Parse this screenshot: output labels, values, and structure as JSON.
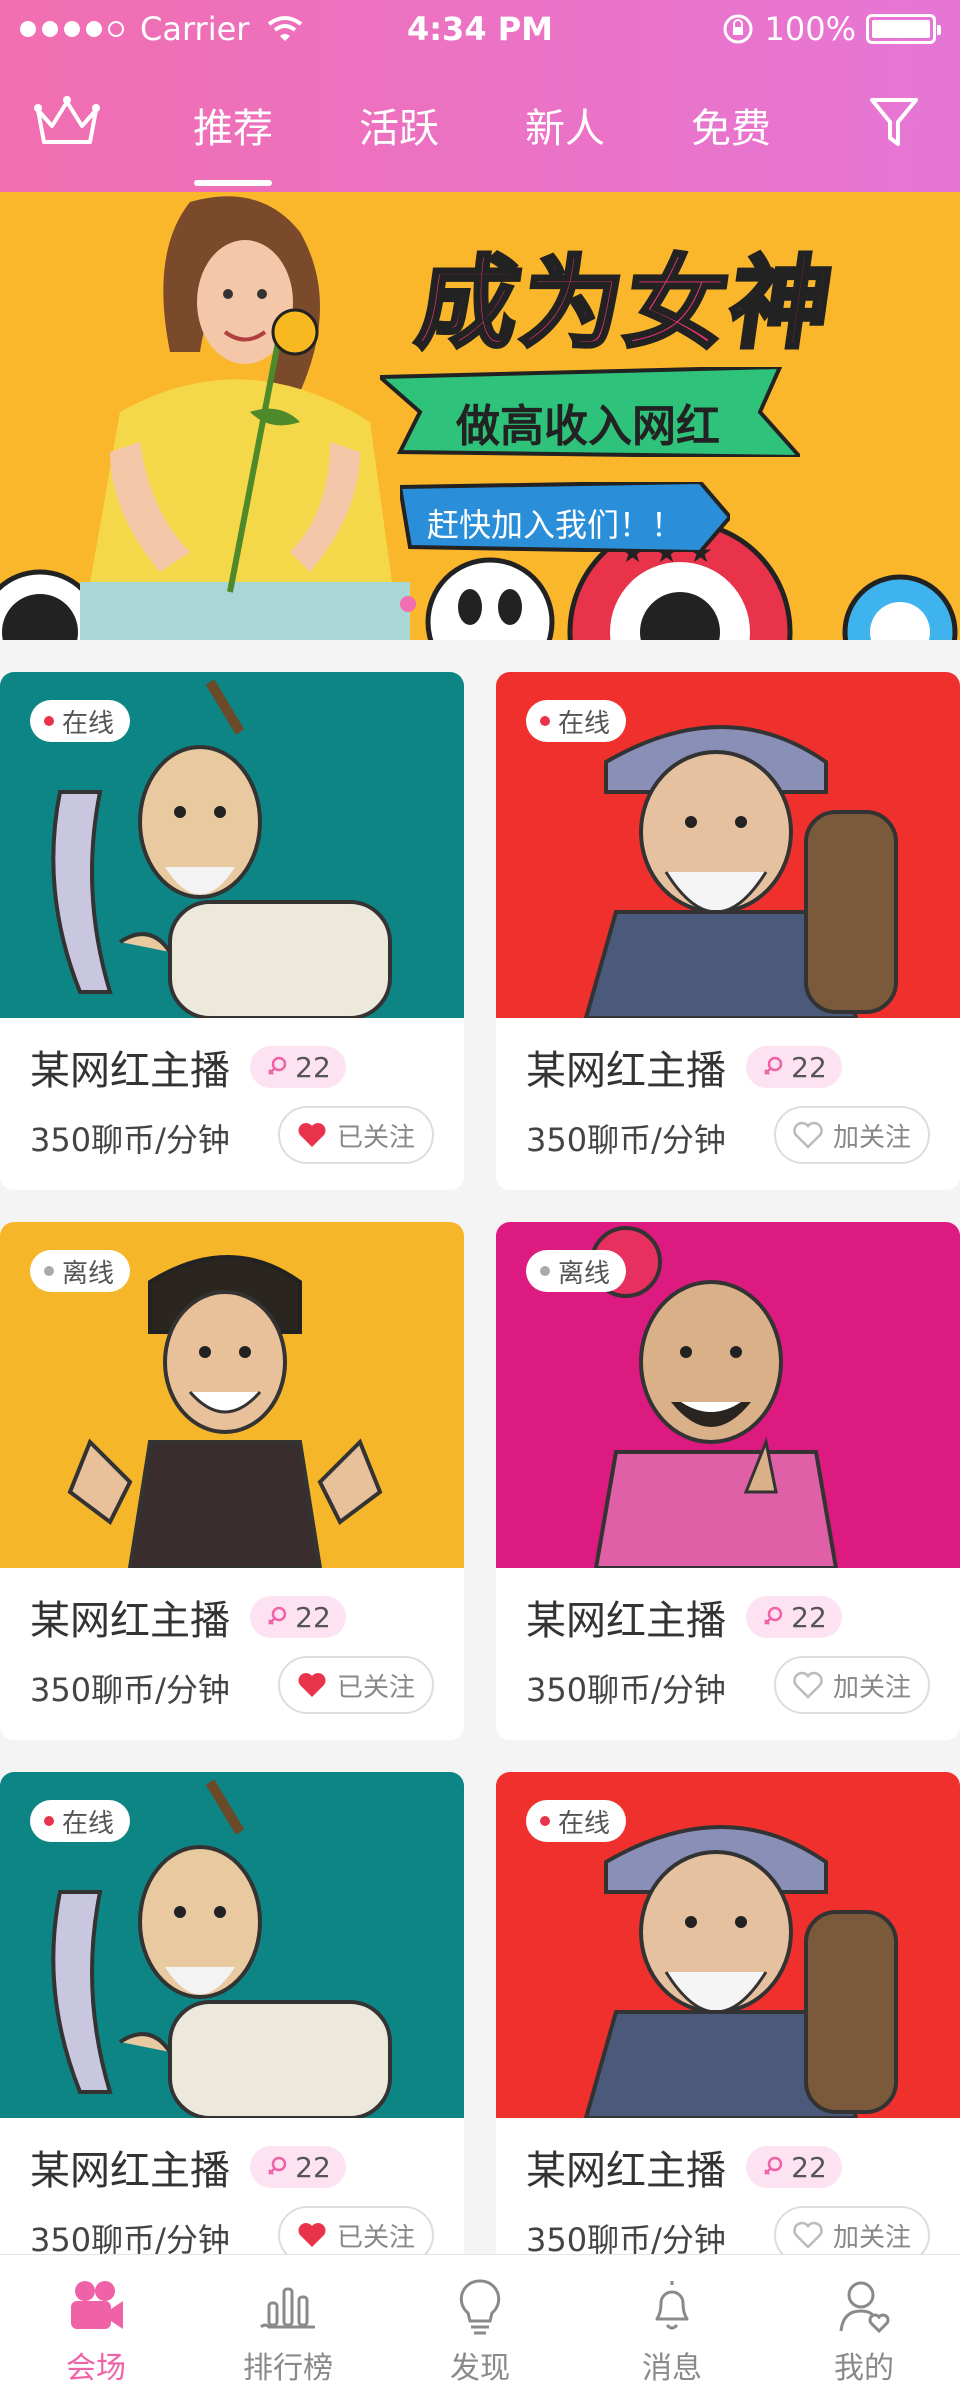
{
  "status_bar": {
    "carrier": "Carrier",
    "time": "4:34 PM",
    "battery": "100%"
  },
  "nav": {
    "tabs": [
      {
        "label": "推荐",
        "active": true
      },
      {
        "label": "活跃",
        "active": false
      },
      {
        "label": "新人",
        "active": false
      },
      {
        "label": "免费",
        "active": false
      }
    ],
    "left_icon": "crown-icon",
    "right_icon": "filter-icon"
  },
  "banner": {
    "title": "成为女神",
    "subtitle": "做高收入网红",
    "cta": "赶快加入我们！！"
  },
  "cards": [
    {
      "status": "在线",
      "status_color": "#e8334a",
      "name": "某网红主播",
      "level": "22",
      "price": "350聊币/分钟",
      "follow": "已关注",
      "followed": true,
      "bg": "#0d8584"
    },
    {
      "status": "在线",
      "status_color": "#e8334a",
      "name": "某网红主播",
      "level": "22",
      "price": "350聊币/分钟",
      "follow": "加关注",
      "followed": false,
      "bg": "#f0302c"
    },
    {
      "status": "离线",
      "status_color": "#aaaaaa",
      "name": "某网红主播",
      "level": "22",
      "price": "350聊币/分钟",
      "follow": "已关注",
      "followed": true,
      "bg": "#f6b62a"
    },
    {
      "status": "离线",
      "status_color": "#aaaaaa",
      "name": "某网红主播",
      "level": "22",
      "price": "350聊币/分钟",
      "follow": "加关注",
      "followed": false,
      "bg": "#dc1a80"
    },
    {
      "status": "在线",
      "status_color": "#e8334a",
      "name": "某网红主播",
      "level": "22",
      "price": "350聊币/分钟",
      "follow": "已关注",
      "followed": true,
      "bg": "#0d8584"
    },
    {
      "status": "在线",
      "status_color": "#e8334a",
      "name": "某网红主播",
      "level": "22",
      "price": "350聊币/分钟",
      "follow": "加关注",
      "followed": false,
      "bg": "#f0302c"
    }
  ],
  "tabbar": [
    {
      "label": "会场",
      "icon": "camera-icon",
      "active": true
    },
    {
      "label": "排行榜",
      "icon": "ranking-icon",
      "active": false
    },
    {
      "label": "发现",
      "icon": "bulb-icon",
      "active": false
    },
    {
      "label": "消息",
      "icon": "bell-icon",
      "active": false
    },
    {
      "label": "我的",
      "icon": "profile-icon",
      "active": false
    }
  ],
  "colors": {
    "accent": "#ef62a8",
    "header_start": "#f16eb0",
    "header_end": "#e676d6",
    "banner_bg": "#fab72b",
    "heart": "#e8334a"
  }
}
